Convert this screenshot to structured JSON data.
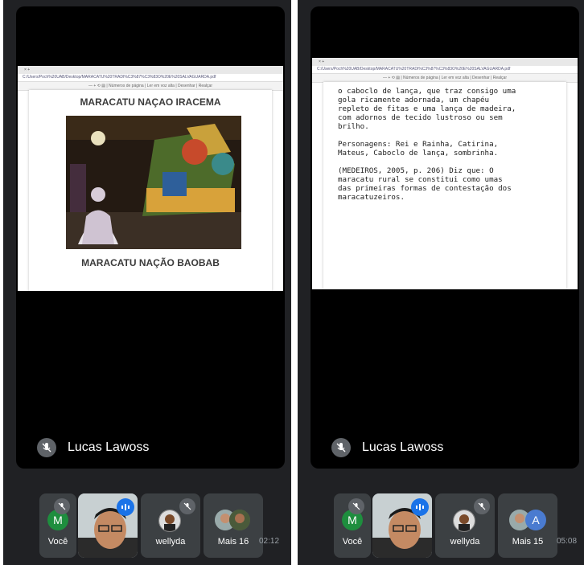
{
  "left": {
    "browser": {
      "tab": "× +",
      "url": "C:/Users/Poch%20UAB/Desktop/MARACATU%20TRADI%C3%87%C3%83O%20E%20SALVAGUARDA.pdf",
      "toolbar": "—  +   ⟲  ▤   |  Números de página  |  Ler em voz alta  |  Desenhar  |  Realçar"
    },
    "pdf": {
      "heading_top": "MARACATU NAÇAO IRACEMA",
      "heading_bottom": "MARACATU NAÇÃO BAOBAB"
    },
    "speaker": {
      "name": "Lucas Lawoss"
    },
    "participants": [
      {
        "initial": "M",
        "label": "Você"
      },
      {
        "label": ""
      },
      {
        "label": "wellyda"
      },
      {
        "label": "Mais 16"
      }
    ],
    "timer": "02:12"
  },
  "right": {
    "browser": {
      "tab": "× +",
      "url": "C:/Users/Poch%20UAB/Desktop/MARACATU%20TRADI%C3%87%C3%83O%20E%20SALVAGUARDA.pdf",
      "toolbar": "—  +   ⟲  ▤   |  Números de página  |  Ler em voz alta  |  Desenhar  |  Realçar"
    },
    "pdf": {
      "text": "o caboclo de lança, que traz consigo uma\ngola ricamente adornada, um chapéu\nrepleto de fitas e uma lança de madeira,\ncom adornos de tecido lustroso ou sem\nbrilho.\n\nPersonagens: Rei e Rainha, Catirina,\nMateus, Caboclo de lança, sombrinha.\n\n(MEDEIROS, 2005, p. 206) Diz que: O\nmaracatu rural se constitui como umas\ndas primeiras formas de contestação dos\nmaracatuzeiros."
    },
    "speaker": {
      "name": "Lucas Lawoss"
    },
    "participants": [
      {
        "initial": "M",
        "label": "Você"
      },
      {
        "label": ""
      },
      {
        "label": "wellyda"
      },
      {
        "initial": "A",
        "label": "Mais 15"
      }
    ],
    "timer": "05:08"
  },
  "colors": {
    "avatar_green": "#1e8e3e",
    "avatar_blue": "#4a7bd0",
    "speaking_blue": "#1a73e8"
  }
}
